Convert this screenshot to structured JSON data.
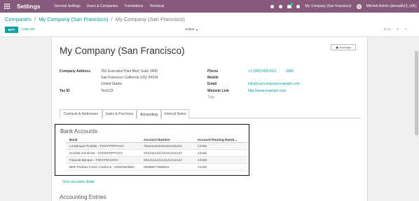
{
  "navbar": {
    "brand": "Settings",
    "menu": [
      "General Settings",
      "Users & Companies",
      "Translations",
      "Technical"
    ],
    "company_switcher": "My Company (San Francisco)",
    "message_count": "4",
    "user": "Mitchell Admin (demodb13_v05)"
  },
  "control_panel": {
    "breadcrumb": [
      "Companies",
      "My Company (San Francisco)"
    ],
    "breadcrumb_sep": "/",
    "current": "My Company (San Francisco)",
    "edit_label": "EDIT",
    "create_label": "CREATE",
    "action_label": "Action",
    "pager_value": "1 / 1",
    "prev": "<",
    "next": ">"
  },
  "form": {
    "title": "My Company (San Francisco)",
    "logo_button": "Your logo",
    "address_label": "Company Address",
    "address_lines": [
      "250 Executive Park Blvd, Suite 3400",
      "San Francisco  California (US)  94134",
      "United States"
    ],
    "taxid_label": "Tax ID",
    "taxid": "Test123",
    "phone_label": "Phone",
    "phone": "+1 (650) 555-0111",
    "sms": "SMS",
    "mobile_label": "Mobile",
    "email_label": "Email",
    "email": "info@yourcompany.example.com",
    "website_label": "Website Link",
    "website": "http://www.example.com",
    "tags_placeholder": "Tags",
    "tabs": [
      "Contacts & Addresses",
      "Sales & Purchase",
      "Accounting",
      "Internal Notes"
    ],
    "active_tab": "Accounting"
  },
  "bank_accounts": {
    "title": "Bank Accounts",
    "columns": [
      "Bank",
      "Account Number",
      "Account Routing Numb..."
    ],
    "rows": [
      [
        "La Banque Postale - PSSTFRPPXXX",
        "764242424242424242424",
        "12345"
      ],
      [
        "Société Générale - SOGEFRPPXXX",
        "201242124212421242124",
        "12345"
      ],
      [
        "Fiducial Banque - FIDCFR21XXX",
        "661212121212121212121",
        "12345"
      ],
      [
        "BNP Paribas Fortis Charleroi - GEBABEBB0...",
        "96998877665544",
        "12345"
      ]
    ],
    "view_detail": "View accounts detail"
  },
  "accounting_entries": {
    "title": "Accounting Entries"
  },
  "colors": {
    "navbar": "#875a7b",
    "accent": "#00a09d"
  }
}
